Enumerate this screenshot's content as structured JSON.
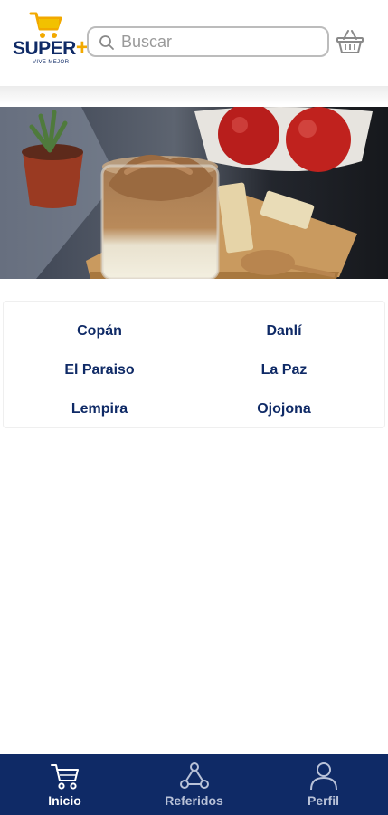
{
  "header": {
    "logo": {
      "word": "SUPER",
      "plus": "+",
      "tagline": "VIVE MEJOR",
      "brand_color": "#0f2a66",
      "accent_color": "#f2a900",
      "icon": "shopping-cart-icon"
    },
    "search": {
      "placeholder": "Buscar",
      "value": "",
      "icon": "search-icon"
    },
    "basket_icon": "basket-icon"
  },
  "banner": {
    "image": "dalgona-coffee-with-apples-and-crackers"
  },
  "cities": [
    {
      "label": "Copán"
    },
    {
      "label": "Danlí"
    },
    {
      "label": "El Paraiso"
    },
    {
      "label": "La Paz"
    },
    {
      "label": "Lempira"
    },
    {
      "label": "Ojojona"
    }
  ],
  "bottom_nav": {
    "background": "#0f2a66",
    "items": [
      {
        "label": "Inicio",
        "icon": "shopping-cart-icon",
        "active": true
      },
      {
        "label": "Referidos",
        "icon": "network-icon",
        "active": false
      },
      {
        "label": "Perfil",
        "icon": "person-icon",
        "active": false
      }
    ]
  }
}
